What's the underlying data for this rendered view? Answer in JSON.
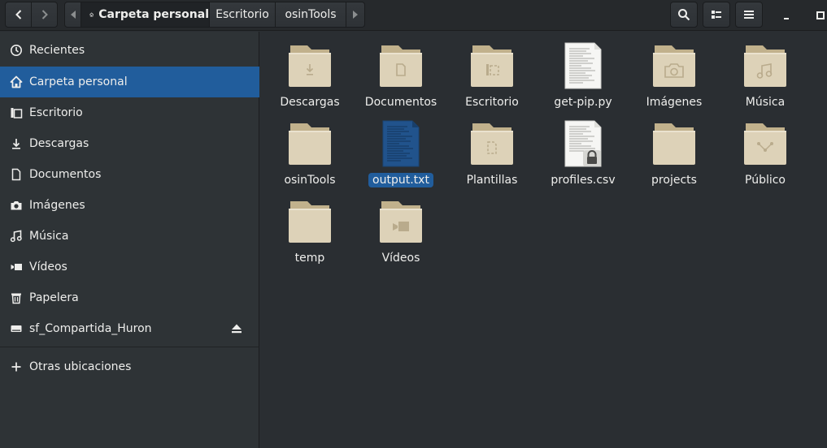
{
  "header": {
    "path": {
      "home_label": "Carpeta personal",
      "segments": [
        "Escritorio",
        "osinTools"
      ]
    },
    "icons": {
      "back": "go-previous-icon",
      "forward": "go-next-icon",
      "search": "search-icon",
      "view": "view-options-icon",
      "menu": "hamburger-menu-icon",
      "minimize": "window-minimize-icon",
      "maximize": "window-maximize-icon"
    }
  },
  "sidebar": {
    "items": [
      {
        "label": "Recientes",
        "icon": "clock-icon"
      },
      {
        "label": "Carpeta personal",
        "icon": "home-icon",
        "active": true
      },
      {
        "label": "Escritorio",
        "icon": "desktop-folder-icon"
      },
      {
        "label": "Descargas",
        "icon": "download-icon"
      },
      {
        "label": "Documentos",
        "icon": "document-icon"
      },
      {
        "label": "Imágenes",
        "icon": "camera-icon"
      },
      {
        "label": "Música",
        "icon": "music-icon"
      },
      {
        "label": "Vídeos",
        "icon": "video-icon"
      },
      {
        "label": "Papelera",
        "icon": "trash-icon"
      },
      {
        "label": "sf_Compartida_Huron",
        "icon": "drive-icon",
        "eject": true
      },
      {
        "label": "Otras ubicaciones",
        "icon": "plus-icon"
      }
    ]
  },
  "files": [
    {
      "name": "Descargas",
      "kind": "folder",
      "emblem": "download"
    },
    {
      "name": "Documentos",
      "kind": "folder",
      "emblem": "document"
    },
    {
      "name": "Escritorio",
      "kind": "folder",
      "emblem": "desktop"
    },
    {
      "name": "get-pip.py",
      "kind": "text-file"
    },
    {
      "name": "Imágenes",
      "kind": "folder",
      "emblem": "camera"
    },
    {
      "name": "Música",
      "kind": "folder",
      "emblem": "music"
    },
    {
      "name": "osinTools",
      "kind": "folder"
    },
    {
      "name": "output.txt",
      "kind": "text-file",
      "selected": true
    },
    {
      "name": "Plantillas",
      "kind": "folder",
      "emblem": "template"
    },
    {
      "name": "profiles.csv",
      "kind": "text-file",
      "locked": true
    },
    {
      "name": "projects",
      "kind": "folder"
    },
    {
      "name": "Público",
      "kind": "folder",
      "emblem": "share"
    },
    {
      "name": "temp",
      "kind": "folder"
    },
    {
      "name": "Vídeos",
      "kind": "folder",
      "emblem": "video"
    }
  ],
  "colors": {
    "accent": "#215d9c",
    "folder": "#ddd2b8",
    "sidebar_bg": "#2e3336",
    "view_bg": "#2a2e32"
  }
}
